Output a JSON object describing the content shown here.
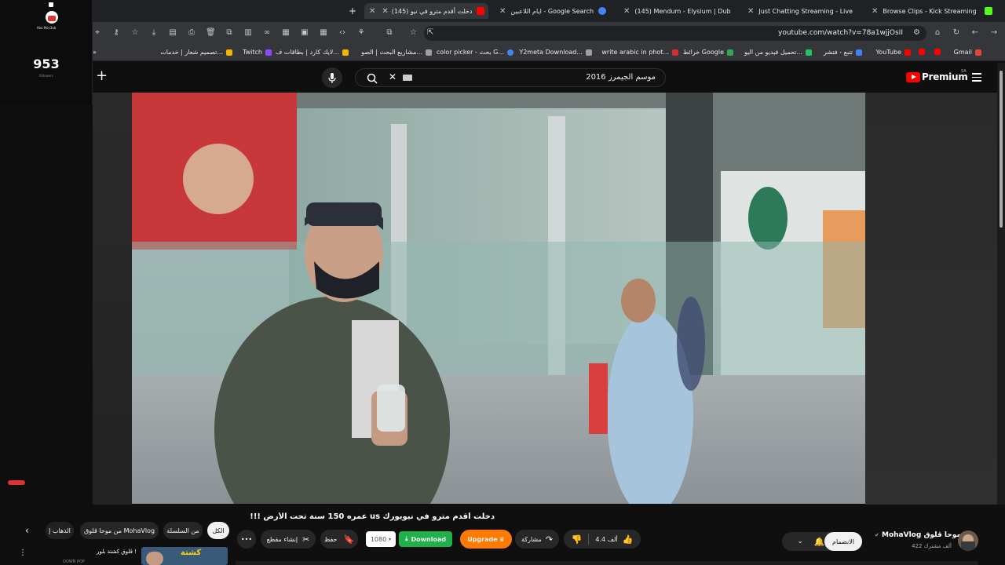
{
  "browser": {
    "tabs": [
      {
        "label": "Browse Clips - Kick Streaming",
        "color": "#53fc18",
        "active": false
      },
      {
        "label": "Just Chatting Streaming - Live",
        "color": "#53fc18",
        "active": false
      },
      {
        "label": "(145) Mendum - Elysium | Dub",
        "color": "#ff0000",
        "active": false
      },
      {
        "label": "ايام اللاعبين - Google Search",
        "color": "#4285f4",
        "active": false
      },
      {
        "label": "(145) دخلت أقدم مترو في نيو",
        "color": "#ff0000",
        "active": true
      }
    ],
    "new_tab": "+",
    "url": "youtube.com/watch?v=78a1wjjOsII",
    "bookmarks": [
      {
        "label": "Gmail",
        "color": "#ea4335"
      },
      {
        "label": "",
        "color": "#ff0000"
      },
      {
        "label": "",
        "color": "#ff0000"
      },
      {
        "label": "YouTube",
        "color": "#ff0000"
      },
      {
        "label": "تتبع - فتشر",
        "color": "#3b82f6"
      },
      {
        "label": "تحميل فيديو من اليو...",
        "color": "#22c55e"
      },
      {
        "label": "خرائط Google",
        "color": "#34a853"
      },
      {
        "label": "write arabic in phot...",
        "color": "#d32f2f"
      },
      {
        "label": "Y2meta Download...",
        "color": "#9e9e9e"
      },
      {
        "label": "color picker - بحث G...",
        "color": "#4285f4"
      },
      {
        "label": "مشاريع البحث | الصو...",
        "color": "#9e9e9e"
      },
      {
        "label": "لايك كارد | بطاقات ف...",
        "color": "#f4b400"
      },
      {
        "label": "Twitch",
        "color": "#9146ff"
      },
      {
        "label": "تصميم شعار | خدمات...",
        "color": "#f4b400"
      }
    ]
  },
  "widget": {
    "name": "Abo Mos3ab",
    "count": "953",
    "sub": "followers"
  },
  "header": {
    "logo": "Premium",
    "region": "SA",
    "search_value": "موسم الجيمرز 2016"
  },
  "video": {
    "title": "دخلت أقدم مترو في نيويورك us عمره 150 سنة تحت الأرض !!!"
  },
  "channel": {
    "name": "MohaVlog موحا ڤلوق",
    "subs": "422 ألف مشترك",
    "join_label": "الانضمام"
  },
  "actions": {
    "likes": "4.4 ألف",
    "share": "مشاركة",
    "upgrade": "Upgrade",
    "download": "Download",
    "quality": "1080",
    "save": "حفظ",
    "clip": "إنشاء مقطع",
    "more": "•••"
  },
  "chips": {
    "all": "الكل",
    "series": "من السلسلة",
    "channel": "من موحا ڤلوق MohaVlog",
    "travel": "الذهاب إ"
  },
  "recommended": {
    "title": "ڤلوق كشتة بلور !",
    "thumb_text": "كشتة",
    "meta": "DOWN POP"
  }
}
